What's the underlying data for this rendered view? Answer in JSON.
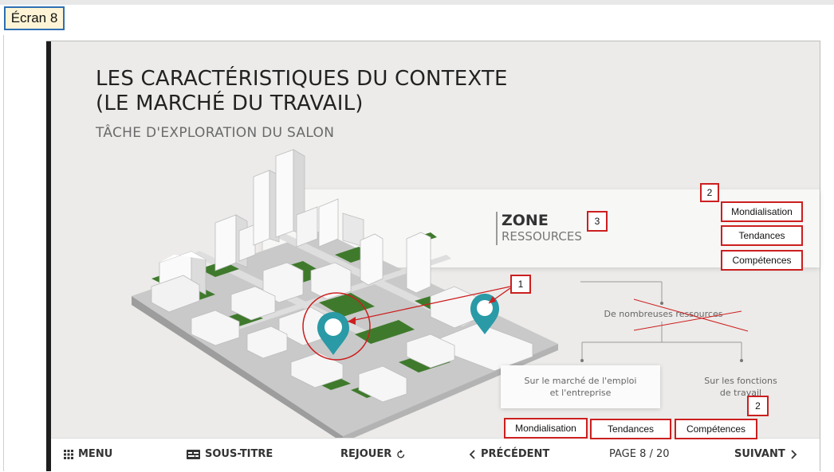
{
  "screen_label": "Écran 8",
  "slide": {
    "title_line1": "LES CARACTÉRISTIQUES DU CONTEXTE",
    "title_line2": "(LE MARCHÉ DU TRAVAIL)",
    "subtitle": "TÂCHE D'EXPLORATION DU SALON",
    "zone_title": "ZONE",
    "zone_subtitle": "RESSOURCES",
    "tree_root": "De nombreuses ressources",
    "tree_left_line1": "Sur le marché de l'emploi",
    "tree_left_line2": "et l'entreprise",
    "tree_right_line1": "Sur les fonctions",
    "tree_right_line2": "de travail"
  },
  "annotations": {
    "marker_1": "1",
    "marker_2_top": "2",
    "marker_2_bottom": "2",
    "marker_3": "3",
    "right_list": [
      "Mondialisation",
      "Tendances",
      "Compétences"
    ],
    "bottom_list": [
      "Mondialisation",
      "Tendances",
      "Compétences"
    ]
  },
  "navbar": {
    "menu": "MENU",
    "subtitles": "SOUS-TITRE",
    "replay": "REJOUER",
    "previous": "PRÉCÉDENT",
    "page": "PAGE 8 / 20",
    "next": "SUIVANT"
  },
  "colors": {
    "teal_pin": "#2a9aa6",
    "annotation_red": "#cc1f1f",
    "grass_green": "#3f7a2c",
    "label_border_blue": "#2e6fb4"
  }
}
